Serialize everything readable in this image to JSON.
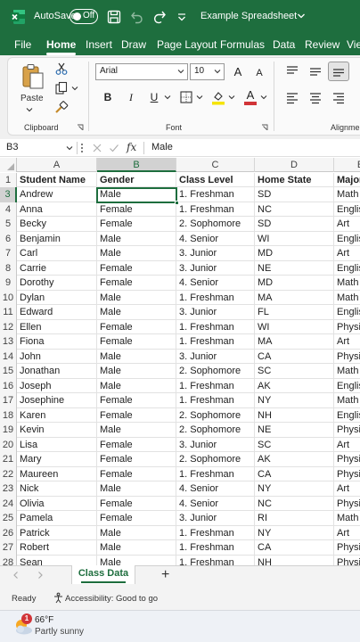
{
  "app": {
    "autosave_label": "AutoSave",
    "autosave_state": "Off",
    "document_name": "Example Spreadsheet",
    "accent_color": "#1e6e3e"
  },
  "menu": {
    "tabs": [
      "File",
      "Home",
      "Insert",
      "Draw",
      "Page Layout",
      "Formulas",
      "Data",
      "Review",
      "View"
    ],
    "active_tab": "Home"
  },
  "ribbon": {
    "paste_label": "Paste",
    "clipboard_label": "Clipboard",
    "font_label": "Font",
    "alignment_label": "Alignmen",
    "font_name": "Arial",
    "font_size": "10",
    "bold": "B",
    "italic": "I",
    "underline": "U",
    "grow_font": "A",
    "shrink_font": "A",
    "font_color_letter": "A"
  },
  "formula_bar": {
    "name_box": "B3",
    "fx": "fx",
    "content": "Male"
  },
  "sheet": {
    "columns": [
      "A",
      "B",
      "C",
      "D",
      "E"
    ],
    "selected_column": "B",
    "selected_row": "3",
    "rows": [
      {
        "num": "1",
        "cells": [
          "Student Name",
          "Gender",
          "Class Level",
          "Home State",
          "Major"
        ]
      },
      {
        "num": "3",
        "cells": [
          "Andrew",
          "Male",
          "1. Freshman",
          "SD",
          "Math"
        ]
      },
      {
        "num": "4",
        "cells": [
          "Anna",
          "Female",
          "1. Freshman",
          "NC",
          "English"
        ]
      },
      {
        "num": "5",
        "cells": [
          "Becky",
          "Female",
          "2. Sophomore",
          "SD",
          "Art"
        ]
      },
      {
        "num": "6",
        "cells": [
          "Benjamin",
          "Male",
          "4. Senior",
          "WI",
          "English"
        ]
      },
      {
        "num": "7",
        "cells": [
          "Carl",
          "Male",
          "3. Junior",
          "MD",
          "Art"
        ]
      },
      {
        "num": "8",
        "cells": [
          "Carrie",
          "Female",
          "3. Junior",
          "NE",
          "English"
        ]
      },
      {
        "num": "9",
        "cells": [
          "Dorothy",
          "Female",
          "4. Senior",
          "MD",
          "Math"
        ]
      },
      {
        "num": "10",
        "cells": [
          "Dylan",
          "Male",
          "1. Freshman",
          "MA",
          "Math"
        ]
      },
      {
        "num": "11",
        "cells": [
          "Edward",
          "Male",
          "3. Junior",
          "FL",
          "English"
        ]
      },
      {
        "num": "12",
        "cells": [
          "Ellen",
          "Female",
          "1. Freshman",
          "WI",
          "Physics"
        ]
      },
      {
        "num": "13",
        "cells": [
          "Fiona",
          "Female",
          "1. Freshman",
          "MA",
          "Art"
        ]
      },
      {
        "num": "14",
        "cells": [
          "John",
          "Male",
          "3. Junior",
          "CA",
          "Physics"
        ]
      },
      {
        "num": "15",
        "cells": [
          "Jonathan",
          "Male",
          "2. Sophomore",
          "SC",
          "Math"
        ]
      },
      {
        "num": "16",
        "cells": [
          "Joseph",
          "Male",
          "1. Freshman",
          "AK",
          "English"
        ]
      },
      {
        "num": "17",
        "cells": [
          "Josephine",
          "Female",
          "1. Freshman",
          "NY",
          "Math"
        ]
      },
      {
        "num": "18",
        "cells": [
          "Karen",
          "Female",
          "2. Sophomore",
          "NH",
          "English"
        ]
      },
      {
        "num": "19",
        "cells": [
          "Kevin",
          "Male",
          "2. Sophomore",
          "NE",
          "Physics"
        ]
      },
      {
        "num": "20",
        "cells": [
          "Lisa",
          "Female",
          "3. Junior",
          "SC",
          "Art"
        ]
      },
      {
        "num": "21",
        "cells": [
          "Mary",
          "Female",
          "2. Sophomore",
          "AK",
          "Physics"
        ]
      },
      {
        "num": "22",
        "cells": [
          "Maureen",
          "Female",
          "1. Freshman",
          "CA",
          "Physics"
        ]
      },
      {
        "num": "23",
        "cells": [
          "Nick",
          "Male",
          "4. Senior",
          "NY",
          "Art"
        ]
      },
      {
        "num": "24",
        "cells": [
          "Olivia",
          "Female",
          "4. Senior",
          "NC",
          "Physics"
        ]
      },
      {
        "num": "25",
        "cells": [
          "Pamela",
          "Female",
          "3. Junior",
          "RI",
          "Math"
        ]
      },
      {
        "num": "26",
        "cells": [
          "Patrick",
          "Male",
          "1. Freshman",
          "NY",
          "Art"
        ]
      },
      {
        "num": "27",
        "cells": [
          "Robert",
          "Male",
          "1. Freshman",
          "CA",
          "Physics"
        ]
      },
      {
        "num": "28",
        "cells": [
          "Sean",
          "Male",
          "1. Freshman",
          "NH",
          "Physics"
        ]
      }
    ]
  },
  "sheet_tabs": {
    "active": "Class Data",
    "add": "+"
  },
  "status": {
    "ready": "Ready",
    "accessibility": "Accessibility: Good to go"
  },
  "taskbar": {
    "badge": "1",
    "temperature": "66°F",
    "condition": "Partly sunny"
  }
}
